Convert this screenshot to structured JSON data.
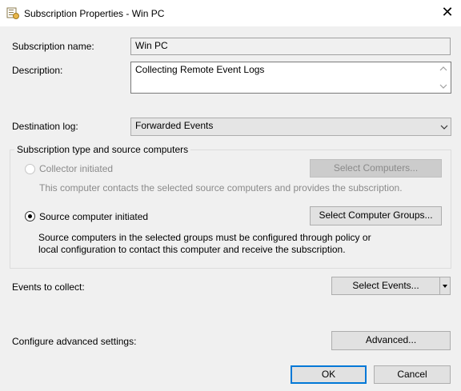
{
  "window": {
    "title": "Subscription Properties - Win PC",
    "close_glyph": "✕"
  },
  "fields": {
    "name_label": "Subscription name:",
    "name_value": "Win PC",
    "description_label": "Description:",
    "description_value": "Collecting Remote Event Logs",
    "destination_label": "Destination log:",
    "destination_value": "Forwarded Events"
  },
  "group": {
    "title": "Subscription type and source computers",
    "collector": {
      "label": "Collector initiated",
      "button": "Select Computers...",
      "info": "This computer contacts the selected source computers and provides the subscription."
    },
    "source": {
      "label": "Source computer initiated",
      "button": "Select Computer Groups...",
      "info_line1": "Source computers in the selected groups must be configured through policy or",
      "info_line2": "local configuration to contact this computer and receive the subscription."
    }
  },
  "events": {
    "label": "Events to collect:",
    "button": "Select Events..."
  },
  "advanced": {
    "label": "Configure advanced settings:",
    "button": "Advanced..."
  },
  "buttons": {
    "ok": "OK",
    "cancel": "Cancel"
  }
}
